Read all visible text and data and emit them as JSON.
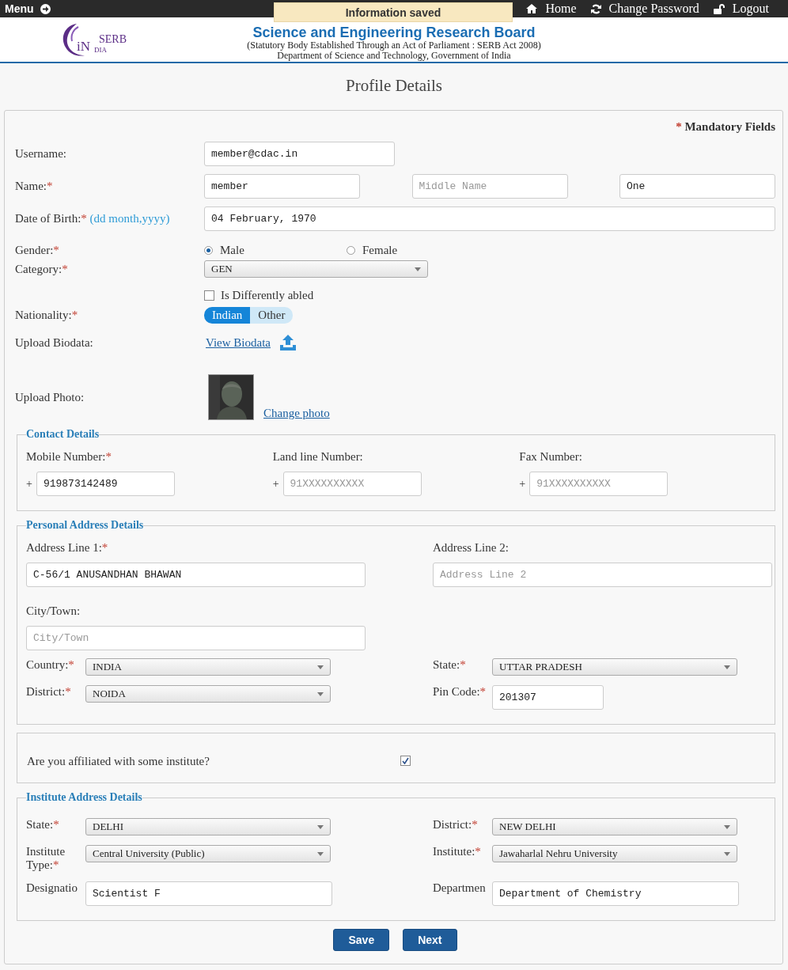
{
  "top_bar": {
    "menu": "Menu",
    "links": [
      {
        "kind": "home",
        "label": "Home"
      },
      {
        "kind": "refresh",
        "label": "Change Password"
      },
      {
        "kind": "unlock",
        "label": "Logout"
      }
    ]
  },
  "toast": "Information saved",
  "header": {
    "logo": {
      "mark": "iN",
      "name": "SERB",
      "sub": "DIA"
    },
    "title": "Science and Engineering Research Board",
    "subtitle": "(Statutory Body Established Through an Act of Parliament : SERB Act 2008)",
    "department": "Department of Science and Technology, Government of India"
  },
  "page_title": "Profile Details",
  "mandatory_note": {
    "star": "*",
    "text": "Mandatory Fields"
  },
  "profile": [
    {
      "kind": "single",
      "label": "Username:",
      "fields": [
        {
          "value": "member@cdac.in"
        }
      ]
    },
    {
      "kind": "triple",
      "label": "Name:",
      "star": "*",
      "fields": [
        {
          "value": "member"
        },
        {
          "placeholder": "Middle Name"
        },
        {
          "value": "One"
        }
      ]
    },
    {
      "kind": "wide",
      "label": "Date of Birth:",
      "star": "*",
      "hint": "(dd month,yyyy)",
      "fields": [
        {
          "value": "04 February, 1970"
        }
      ]
    },
    {
      "kind": "radio",
      "label": "Gender:",
      "star": "*",
      "options": [
        {
          "label": "Male",
          "selected": true
        },
        {
          "label": "Female",
          "selected": false
        }
      ]
    },
    {
      "kind": "select",
      "label": "Category:",
      "star": "*",
      "value": "GEN"
    },
    {
      "kind": "checkbox",
      "text": "Is Differently abled",
      "checked": false
    },
    {
      "kind": "toggle",
      "label": "Nationality:",
      "star": "*",
      "options": [
        {
          "label": "Indian",
          "selected": true
        },
        {
          "label": "Other",
          "selected": false
        }
      ]
    },
    {
      "kind": "upload",
      "label": "Upload Biodata:",
      "link": "View Biodata"
    },
    {
      "label": "Upload Photo:",
      "link": "Change photo"
    }
  ],
  "contact": {
    "title": "Contact Details",
    "fields": [
      {
        "label": "Mobile Number:",
        "star": "*",
        "prefix": "+",
        "value": "919873142489"
      },
      {
        "label": "Land line Number:",
        "prefix": "+",
        "placeholder": "91XXXXXXXXXX"
      },
      {
        "label": "Fax Number:",
        "prefix": "+",
        "placeholder": "91XXXXXXXXXX"
      }
    ]
  },
  "personal_address": {
    "title": "Personal Address Details",
    "stacked_fields": [
      {
        "label": "Address Line 1:",
        "star": "*",
        "value": "C-56/1 ANUSANDHAN BHAWAN"
      },
      {
        "label": "Address Line 2:",
        "placeholder": "Address Line 2"
      },
      {
        "label": "City/Town:",
        "placeholder": "City/Town"
      }
    ],
    "inline_fields": [
      {
        "kind": "select",
        "label": "Country:",
        "star": "*",
        "value": "INDIA"
      },
      {
        "kind": "select",
        "label": "State:",
        "star": "*",
        "value": "UTTAR PRADESH"
      },
      {
        "kind": "select",
        "label": "District:",
        "star": "*",
        "value": "NOIDA"
      },
      {
        "kind": "input",
        "label": "Pin Code:",
        "star": "*",
        "value": "201307"
      }
    ]
  },
  "affiliation": {
    "question": "Are you affiliated with some institute?",
    "checked": true
  },
  "institute_address": {
    "title": "Institute Address Details",
    "inline_fields": [
      {
        "kind": "select",
        "label": "State:",
        "star": "*",
        "value": "DELHI"
      },
      {
        "kind": "select",
        "label": "District:",
        "star": "*",
        "value": "NEW DELHI"
      },
      {
        "kind": "select",
        "label": "Institute Type:",
        "star": "*",
        "value": "Central University (Public)"
      },
      {
        "kind": "select",
        "label": "Institute:",
        "star": "*",
        "value": "Jawaharlal Nehru University"
      },
      {
        "kind": "input",
        "label": "Designatio",
        "value": "Scientist F"
      },
      {
        "kind": "input",
        "label": "Departmen",
        "value": "Department of Chemistry"
      }
    ]
  },
  "buttons": [
    {
      "label": "Save"
    },
    {
      "label": "Next"
    }
  ]
}
